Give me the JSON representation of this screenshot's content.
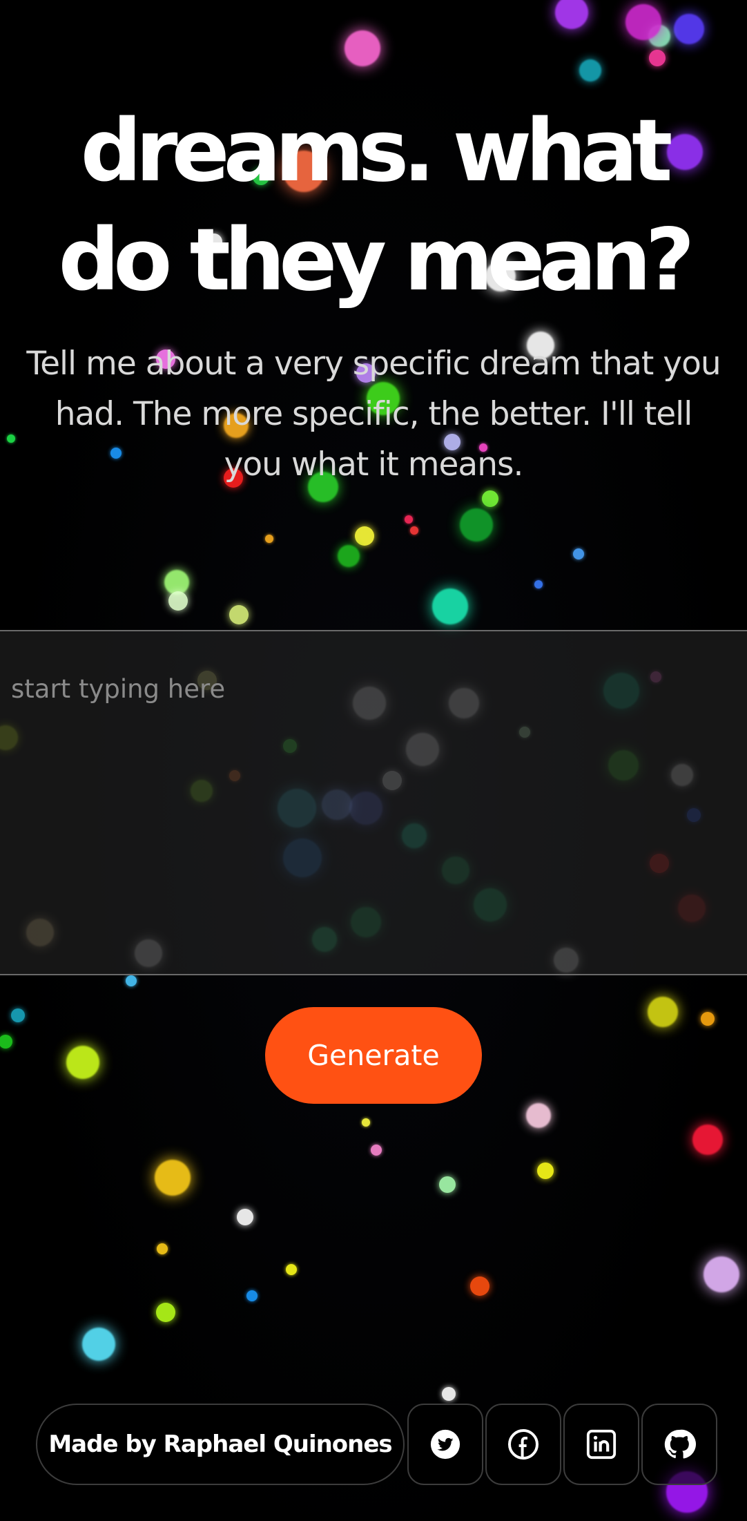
{
  "hero": {
    "title": "dreams. what do they mean?",
    "subtitle": "Tell me about a very specific dream that you had. The more specific, the better. I'll tell you what it means."
  },
  "form": {
    "placeholder": "start typing here",
    "value": "",
    "generate_label": "Generate"
  },
  "footer": {
    "credit": "Made by Raphael Quinones",
    "social_icons": [
      "twitter-icon",
      "facebook-icon",
      "linkedin-icon",
      "github-icon"
    ]
  },
  "colors": {
    "background": "#000000",
    "accent": "#ff5113",
    "text": "#ffffff",
    "muted_text": "#d9d9d9"
  }
}
